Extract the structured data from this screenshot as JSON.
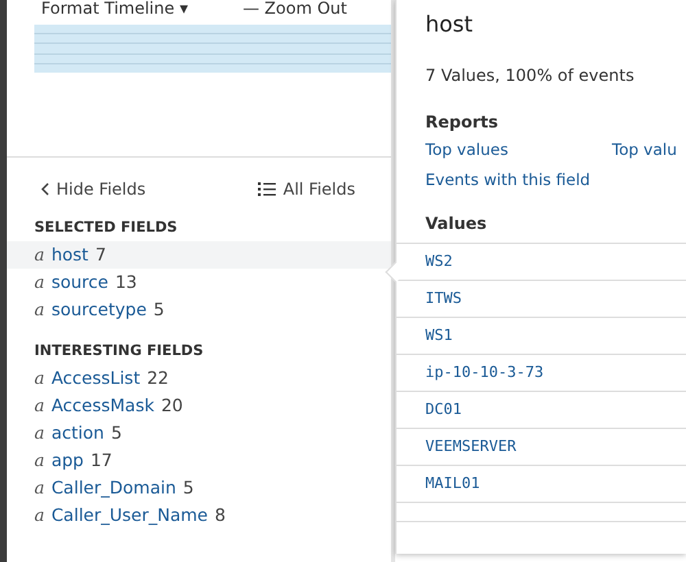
{
  "toolbar": {
    "format_timeline": "Format Timeline",
    "format_caret": "▾",
    "zoom_out_icon": "—",
    "zoom_out": "Zoom Out"
  },
  "fields_header": {
    "hide_fields": "Hide Fields",
    "all_fields": "All Fields"
  },
  "sections": [
    {
      "title": "SELECTED FIELDS",
      "fields": [
        {
          "type": "a",
          "name": "host",
          "count": "7",
          "selected": true
        },
        {
          "type": "a",
          "name": "source",
          "count": "13",
          "selected": false
        },
        {
          "type": "a",
          "name": "sourcetype",
          "count": "5",
          "selected": false
        }
      ]
    },
    {
      "title": "INTERESTING FIELDS",
      "fields": [
        {
          "type": "a",
          "name": "AccessList",
          "count": "22",
          "selected": false
        },
        {
          "type": "a",
          "name": "AccessMask",
          "count": "20",
          "selected": false
        },
        {
          "type": "a",
          "name": "action",
          "count": "5",
          "selected": false
        },
        {
          "type": "a",
          "name": "app",
          "count": "17",
          "selected": false
        },
        {
          "type": "a",
          "name": "Caller_Domain",
          "count": "5",
          "selected": false
        },
        {
          "type": "a",
          "name": "Caller_User_Name",
          "count": "8",
          "selected": false
        }
      ]
    }
  ],
  "popup": {
    "title": "host",
    "summary": "7 Values, 100% of events",
    "reports_heading": "Reports",
    "reports": [
      "Top values",
      "Top valu",
      "Events with this field"
    ],
    "values_heading": "Values",
    "values": [
      "WS2",
      "ITWS",
      "WS1",
      "ip-10-10-3-73",
      "DC01",
      "VEEMSERVER",
      "MAIL01"
    ]
  }
}
